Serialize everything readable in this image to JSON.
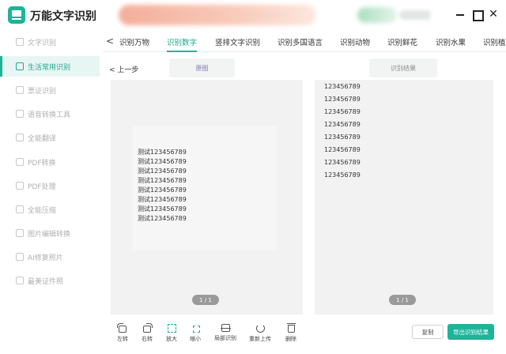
{
  "app": {
    "title": "万能文字识别"
  },
  "window": {
    "minimize_icon": "minimize-icon",
    "maximize_icon": "maximize-icon",
    "close": "✕"
  },
  "sidebar": {
    "items": [
      {
        "label": "文字识别",
        "active": false
      },
      {
        "label": "生活常用识别",
        "active": true
      },
      {
        "label": "票证识别",
        "active": false
      },
      {
        "label": "语音转换工具",
        "active": false
      },
      {
        "label": "全能翻译",
        "active": false
      },
      {
        "label": "PDF转换",
        "active": false
      },
      {
        "label": "PDF处理",
        "active": false
      },
      {
        "label": "全能压缩",
        "active": false
      },
      {
        "label": "图片编辑转换",
        "active": false
      },
      {
        "label": "AI修复照片",
        "active": false
      },
      {
        "label": "最美证件照",
        "active": false
      }
    ]
  },
  "tabs": {
    "prev_arrow": "<",
    "items": [
      {
        "label": "识别万物",
        "active": false
      },
      {
        "label": "识别数字",
        "active": true
      },
      {
        "label": "竖排文字识别",
        "active": false
      },
      {
        "label": "识别多国语言",
        "active": false
      },
      {
        "label": "识别动物",
        "active": false
      },
      {
        "label": "识别鲜花",
        "active": false
      },
      {
        "label": "识别水果",
        "active": false
      },
      {
        "label": "识别植",
        "active": false
      }
    ]
  },
  "main": {
    "back_label": "< 上一步",
    "original_header": "原图",
    "result_header": "识别结果",
    "original_lines": [
      "测试123456789",
      "测试123456789",
      "测试123456789",
      "测试123456789",
      "测试123456789",
      "测试123456789",
      "测试123456789",
      "测试123456789"
    ],
    "result_lines": [
      "123456789",
      "123456789",
      "123456789",
      "123456789",
      "123456789",
      "123456789",
      "123456789",
      "123456789"
    ],
    "left_pager": "1 / 1",
    "right_pager": "1 / 1"
  },
  "toolbar": {
    "items": [
      {
        "label": "左转",
        "icon": "rotate-left-icon"
      },
      {
        "label": "右转",
        "icon": "rotate-right-icon"
      },
      {
        "label": "放大",
        "icon": "zoom-in-icon"
      },
      {
        "label": "缩小",
        "icon": "zoom-out-icon"
      },
      {
        "label": "局部识别",
        "icon": "partial-recognize-icon"
      },
      {
        "label": "重新上传",
        "icon": "reupload-icon"
      },
      {
        "label": "删除",
        "icon": "delete-icon"
      }
    ]
  },
  "actions": {
    "copy_label": "复制",
    "export_label": "导出识别结果"
  },
  "colors": {
    "accent": "#1fb39a",
    "panel_bg": "#f2f2f2",
    "active_nav_bg": "#e8f6f3"
  }
}
